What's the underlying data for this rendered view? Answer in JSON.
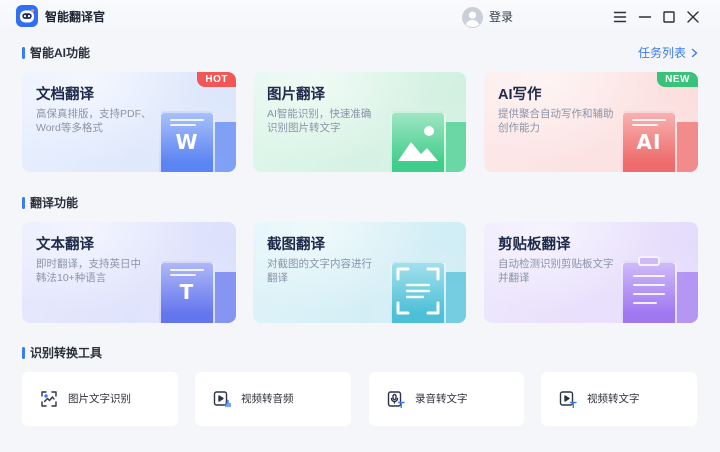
{
  "app": {
    "title": "智能翻译官",
    "login_label": "登录",
    "icons": {
      "logo": "robot-logo-icon",
      "avatar": "user-avatar-icon",
      "menu": "menu-icon",
      "minimize": "minimize-icon",
      "maximize": "maximize-icon",
      "close": "close-icon"
    }
  },
  "colors": {
    "accent": "#3a7bf7",
    "page_bg": "#f4f6f9",
    "title_text": "#1e2a4a",
    "desc_text": "#8a93a7",
    "tool_bg": "#ffffff"
  },
  "ai_section": {
    "title": "智能AI功能",
    "task_list_label": "任务列表",
    "task_list_icon": "chevron-right-icon",
    "cards": [
      {
        "title": "文档翻译",
        "desc": "高保真排版，支持PDF、\nWord等多格式",
        "badge": {
          "text": "HOT",
          "color": "#f25757"
        },
        "illustration": {
          "icon": "word-document-icon",
          "glyph": "W"
        },
        "theme": {
          "bg": [
            "#e9f0fe",
            "#d9e4fb"
          ],
          "accent": "#5a83f3",
          "accent_light": "#a8c0fa"
        }
      },
      {
        "title": "图片翻译",
        "desc": "AI智能识别，快速准确\n识别图片转文字",
        "illustration": {
          "icon": "picture-icon"
        },
        "theme": {
          "bg": [
            "#e1f7ec",
            "#cfefdf"
          ],
          "accent": "#40cc8a",
          "accent_light": "#9fe6c3"
        }
      },
      {
        "title": "AI写作",
        "desc": "提供聚合自动写作和辅助\n创作能力",
        "badge": {
          "text": "NEW",
          "color": "#38c27a"
        },
        "illustration": {
          "icon": "ai-document-icon",
          "glyph": "AI"
        },
        "theme": {
          "bg": [
            "#fdeaea",
            "#fbdcdc"
          ],
          "accent": "#ef6a6a",
          "accent_light": "#f8b1b1"
        }
      }
    ]
  },
  "translate_section": {
    "title": "翻译功能",
    "cards": [
      {
        "title": "文本翻译",
        "desc": "即时翻译，支持英日中\n韩法10+种语言",
        "illustration": {
          "icon": "text-document-icon",
          "glyph": "T"
        },
        "theme": {
          "bg": [
            "#e8ebfd",
            "#d9defb"
          ],
          "accent": "#6476ee",
          "accent_light": "#aeb8f7"
        }
      },
      {
        "title": "截图翻译",
        "desc": "对截图的文字内容进行\n翻译",
        "illustration": {
          "icon": "screenshot-frame-icon"
        },
        "theme": {
          "bg": [
            "#e0f4f9",
            "#cdebf4"
          ],
          "accent": "#4dbfd7",
          "accent_light": "#a2e0ed"
        }
      },
      {
        "title": "剪贴板翻译",
        "desc": "自动检测识别剪贴板文字\n并翻译",
        "illustration": {
          "icon": "clipboard-icon"
        },
        "theme": {
          "bg": [
            "#efe9fd",
            "#e3d9fb"
          ],
          "accent": "#9f78f0",
          "accent_light": "#cfbaf8"
        }
      }
    ]
  },
  "tools_section": {
    "title": "识别转换工具",
    "tools": [
      {
        "label": "图片文字识别",
        "icon": "image-text-scan-icon"
      },
      {
        "label": "视频转音频",
        "icon": "video-to-audio-icon"
      },
      {
        "label": "录音转文字",
        "icon": "audio-to-text-icon"
      },
      {
        "label": "视频转文字",
        "icon": "video-to-text-icon"
      }
    ]
  }
}
